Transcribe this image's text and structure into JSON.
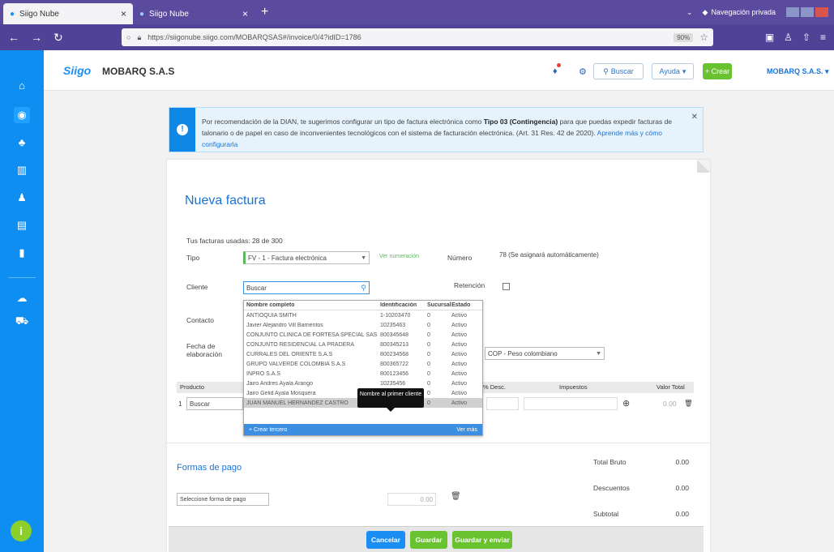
{
  "browser": {
    "tabs": [
      {
        "title": "Siigo Nube",
        "close": "×"
      },
      {
        "title": "Siigo Nube",
        "close": "×"
      }
    ],
    "new_tab": "+",
    "private_label": "Navegación privada",
    "url": "https://siigonube.siigo.com/MOBARQSAS#/invoice/0/4?idID=1786",
    "zoom": "90%"
  },
  "topbar": {
    "logo": "Siigo",
    "company": "MOBARQ S.A.S",
    "search_label": "Buscar",
    "help_label": "Ayuda",
    "create_label": "Crear",
    "user_label": "MOBARQ S.A.S."
  },
  "alert": {
    "text_before": "Por recomendación de la DIAN, te sugerimos configurar un tipo de factura electrónica como ",
    "bold": "Tipo 03 (Contingencia)",
    "text_after": " para que puedas expedir facturas de talonario o de papel en caso de inconvenientes tecnológicos con el sistema de facturación electrónica. (Art. 31 Res. 42 de 2020).",
    "link": "Aprende más y cómo configurarla"
  },
  "invoice": {
    "title": "Nueva factura",
    "available": "Tus facturas usadas: 28 de 300",
    "tipo_label": "Tipo",
    "tipo_value": "FV - 1 - Factura electrónica",
    "ver_numeracion": "Ver numeración",
    "numero_label": "Número",
    "numero_value": "78 (Se asignará automáticamente)",
    "cliente_label": "Cliente",
    "cliente_value": "Buscar",
    "contacto_label": "Contacto",
    "fecha_label": "Fecha de elaboración",
    "retencion_label": "Retención",
    "moneda_value": "COP - Peso colombiano",
    "table_headers": [
      "Producto",
      "Valor Total"
    ],
    "table_headers_mid": [
      "% Desc.",
      "Impuestos"
    ],
    "row_number": "1",
    "row_value": "0.00",
    "row_search": "Buscar"
  },
  "dropdown": {
    "headers": [
      "Nombre completo",
      "Identificación",
      "Sucursal",
      "Estado"
    ],
    "rows": [
      [
        "ANTIOQUIA SMITH",
        "1-10203470",
        "0",
        "Activo"
      ],
      [
        "Javier Alejandro Vill Barrientos",
        "10235463",
        "0",
        "Activo"
      ],
      [
        "CONJUNTO CLINICA DE FORTESA SPECIAL SAS",
        "800345648",
        "0",
        "Activo"
      ],
      [
        "CONJUNTO RESIDENCIAL LA PRADERA",
        "800345213",
        "0",
        "Activo"
      ],
      [
        "CURRALES DEL ORIENTE S.A.S",
        "800234568",
        "0",
        "Activo"
      ],
      [
        "GRUPO VALVERDE COLOMBIA S.A.S",
        "800365722",
        "0",
        "Activo"
      ],
      [
        "INPRO S.A.S",
        "800123456",
        "0",
        "Activo"
      ],
      [
        "Jairo Andres Ayala Arango",
        "10235456",
        "0",
        "Activo"
      ],
      [
        "Jairo Gelid Ayala Mosquera",
        "1036405588",
        "0",
        "Activo"
      ],
      [
        "JUAN MANUEL HERNANDEZ CASTRO",
        "80234574",
        "0",
        "Activo"
      ]
    ],
    "footer_left": "+ Crear tercero",
    "footer_right": "Ver más",
    "tooltip": "Nombre al primer cliente"
  },
  "payment": {
    "title": "Formas de pago",
    "select_placeholder": "Seleccione forma de pago",
    "value": "0.00"
  },
  "totals": [
    {
      "label": "Total Bruto",
      "value": "0.00"
    },
    {
      "label": "Descuentos",
      "value": "0.00"
    },
    {
      "label": "Subtotal",
      "value": "0.00"
    }
  ],
  "footer": {
    "cancel": "Cancelar",
    "save": "Guardar",
    "save_send": "Guardar y enviar"
  }
}
